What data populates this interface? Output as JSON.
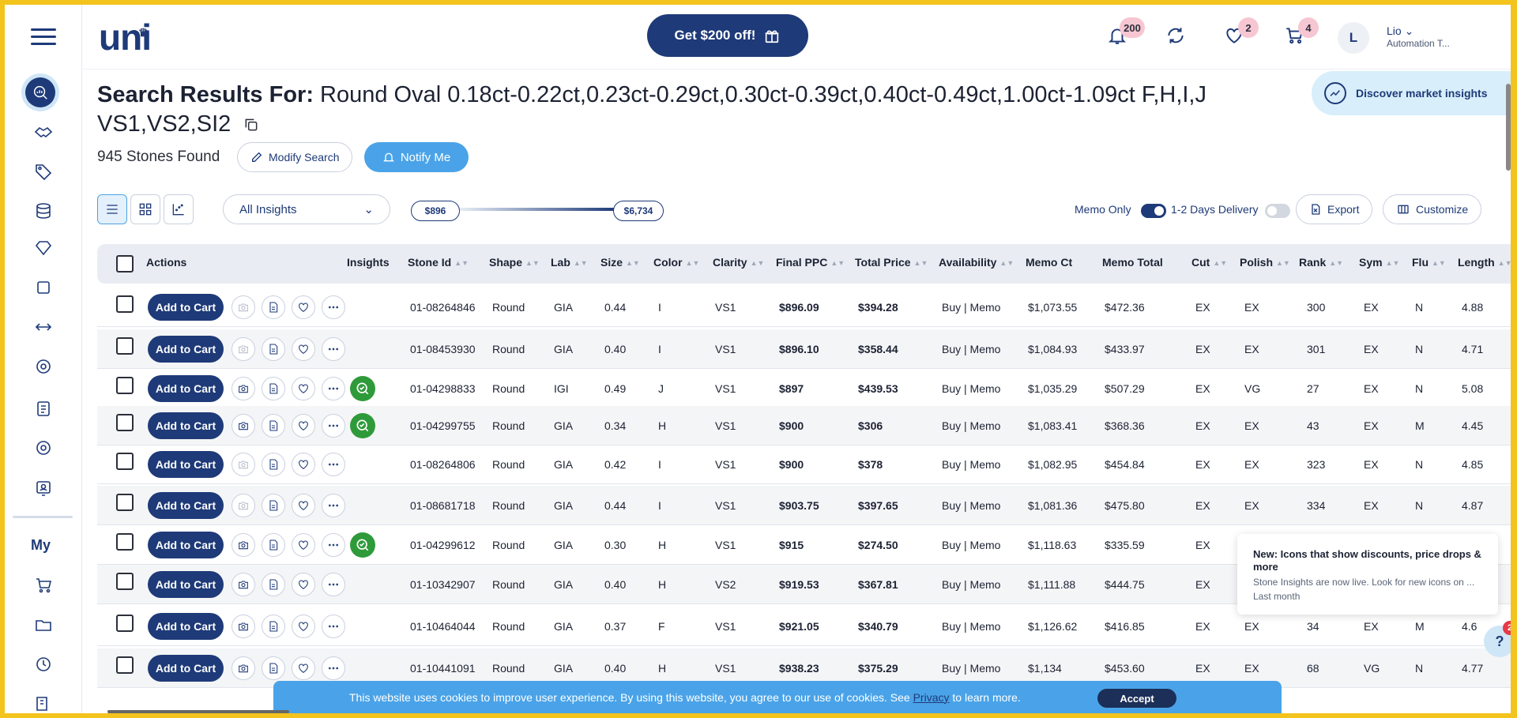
{
  "header": {
    "logo": "uni",
    "promo_label": "Get $200 off!",
    "notifications_count": "200",
    "wishlist_count": "2",
    "cart_count": "4",
    "avatar_initial": "L",
    "user_name": "Lio",
    "user_role": "Automation T..."
  },
  "sidebar": {
    "my_label": "My"
  },
  "search": {
    "title_prefix": "Search Results For:",
    "query": "Round Oval 0.18ct-0.22ct,0.23ct-0.29ct,0.30ct-0.39ct,0.40ct-0.49ct,1.00ct-1.09ct F,H,I,J VS1,VS2,SI2",
    "found": "945 Stones Found",
    "modify_label": "Modify Search",
    "notify_label": "Notify Me",
    "discover_label": "Discover market insights"
  },
  "toolbar": {
    "insights_select": "All Insights",
    "price_min": "$896",
    "price_max": "$6,734",
    "memo_only_label": "Memo Only",
    "memo_only_on": true,
    "delivery_label": "1-2 Days Delivery",
    "delivery_on": false,
    "export_label": "Export",
    "customize_label": "Customize"
  },
  "table": {
    "headers": [
      "Actions",
      "Insights",
      "Stone Id",
      "Shape",
      "Lab",
      "Size",
      "Color",
      "Clarity",
      "Final PPC",
      "Total Price",
      "Availability",
      "Memo Ct",
      "Memo Total",
      "Cut",
      "Polish",
      "Rank",
      "Sym",
      "Flu",
      "Length"
    ],
    "add_label": "Add to Cart",
    "rows": [
      {
        "id": "01-08264846",
        "shape": "Round",
        "lab": "GIA",
        "size": "0.44",
        "color": "I",
        "clarity": "VS1",
        "ppc": "$896.09",
        "total": "$394.28",
        "avail": "Buy | Memo",
        "memo_ct": "$1,073.55",
        "memo_total": "$472.36",
        "cut": "EX",
        "polish": "EX",
        "rank": "300",
        "sym": "EX",
        "flu": "N",
        "length": "4.88",
        "insight": false,
        "camera": false
      },
      {
        "id": "01-08453930",
        "shape": "Round",
        "lab": "GIA",
        "size": "0.40",
        "color": "I",
        "clarity": "VS1",
        "ppc": "$896.10",
        "total": "$358.44",
        "avail": "Buy | Memo",
        "memo_ct": "$1,084.93",
        "memo_total": "$433.97",
        "cut": "EX",
        "polish": "EX",
        "rank": "301",
        "sym": "EX",
        "flu": "N",
        "length": "4.71",
        "insight": false,
        "camera": false
      },
      {
        "id": "01-04298833",
        "shape": "Round",
        "lab": "IGI",
        "size": "0.49",
        "color": "J",
        "clarity": "VS1",
        "ppc": "$897",
        "total": "$439.53",
        "avail": "Buy | Memo",
        "memo_ct": "$1,035.29",
        "memo_total": "$507.29",
        "cut": "EX",
        "polish": "VG",
        "rank": "27",
        "sym": "EX",
        "flu": "N",
        "length": "5.08",
        "insight": true,
        "camera": true
      },
      {
        "id": "01-04299755",
        "shape": "Round",
        "lab": "GIA",
        "size": "0.34",
        "color": "H",
        "clarity": "VS1",
        "ppc": "$900",
        "total": "$306",
        "avail": "Buy | Memo",
        "memo_ct": "$1,083.41",
        "memo_total": "$368.36",
        "cut": "EX",
        "polish": "EX",
        "rank": "43",
        "sym": "EX",
        "flu": "M",
        "length": "4.45",
        "insight": true,
        "camera": true
      },
      {
        "id": "01-08264806",
        "shape": "Round",
        "lab": "GIA",
        "size": "0.42",
        "color": "I",
        "clarity": "VS1",
        "ppc": "$900",
        "total": "$378",
        "avail": "Buy | Memo",
        "memo_ct": "$1,082.95",
        "memo_total": "$454.84",
        "cut": "EX",
        "polish": "EX",
        "rank": "323",
        "sym": "EX",
        "flu": "N",
        "length": "4.85",
        "insight": false,
        "camera": false
      },
      {
        "id": "01-08681718",
        "shape": "Round",
        "lab": "GIA",
        "size": "0.44",
        "color": "I",
        "clarity": "VS1",
        "ppc": "$903.75",
        "total": "$397.65",
        "avail": "Buy | Memo",
        "memo_ct": "$1,081.36",
        "memo_total": "$475.80",
        "cut": "EX",
        "polish": "EX",
        "rank": "334",
        "sym": "EX",
        "flu": "N",
        "length": "4.87",
        "insight": false,
        "camera": false
      },
      {
        "id": "01-04299612",
        "shape": "Round",
        "lab": "GIA",
        "size": "0.30",
        "color": "H",
        "clarity": "VS1",
        "ppc": "$915",
        "total": "$274.50",
        "avail": "Buy | Memo",
        "memo_ct": "$1,118.63",
        "memo_total": "$335.59",
        "cut": "EX",
        "polish": "",
        "rank": "",
        "sym": "",
        "flu": "",
        "length": "",
        "insight": true,
        "camera": true
      },
      {
        "id": "01-10342907",
        "shape": "Round",
        "lab": "GIA",
        "size": "0.40",
        "color": "H",
        "clarity": "VS2",
        "ppc": "$919.53",
        "total": "$367.81",
        "avail": "Buy | Memo",
        "memo_ct": "$1,111.88",
        "memo_total": "$444.75",
        "cut": "EX",
        "polish": "",
        "rank": "",
        "sym": "",
        "flu": "",
        "length": "",
        "insight": false,
        "camera": true
      },
      {
        "id": "01-10464044",
        "shape": "Round",
        "lab": "GIA",
        "size": "0.37",
        "color": "F",
        "clarity": "VS1",
        "ppc": "$921.05",
        "total": "$340.79",
        "avail": "Buy | Memo",
        "memo_ct": "$1,126.62",
        "memo_total": "$416.85",
        "cut": "EX",
        "polish": "EX",
        "rank": "34",
        "sym": "EX",
        "flu": "M",
        "length": "4.6",
        "insight": false,
        "camera": true
      },
      {
        "id": "01-10441091",
        "shape": "Round",
        "lab": "GIA",
        "size": "0.40",
        "color": "H",
        "clarity": "VS1",
        "ppc": "$938.23",
        "total": "$375.29",
        "avail": "Buy | Memo",
        "memo_ct": "$1,134",
        "memo_total": "$453.60",
        "cut": "EX",
        "polish": "EX",
        "rank": "68",
        "sym": "VG",
        "flu": "N",
        "length": "4.77",
        "insight": false,
        "camera": true
      }
    ]
  },
  "toast": {
    "title": "New: Icons that show discounts, price drops & more",
    "desc": "Stone Insights are now live. Look for new icons on ...",
    "meta": "Last month"
  },
  "help": {
    "label": "?",
    "badge": "2"
  },
  "cookie": {
    "text": "This website uses cookies to improve user experience. By using this website, you agree to our use of cookies. See",
    "link": "Privacy",
    "tail": "to learn more.",
    "accept_label": "Accept"
  }
}
